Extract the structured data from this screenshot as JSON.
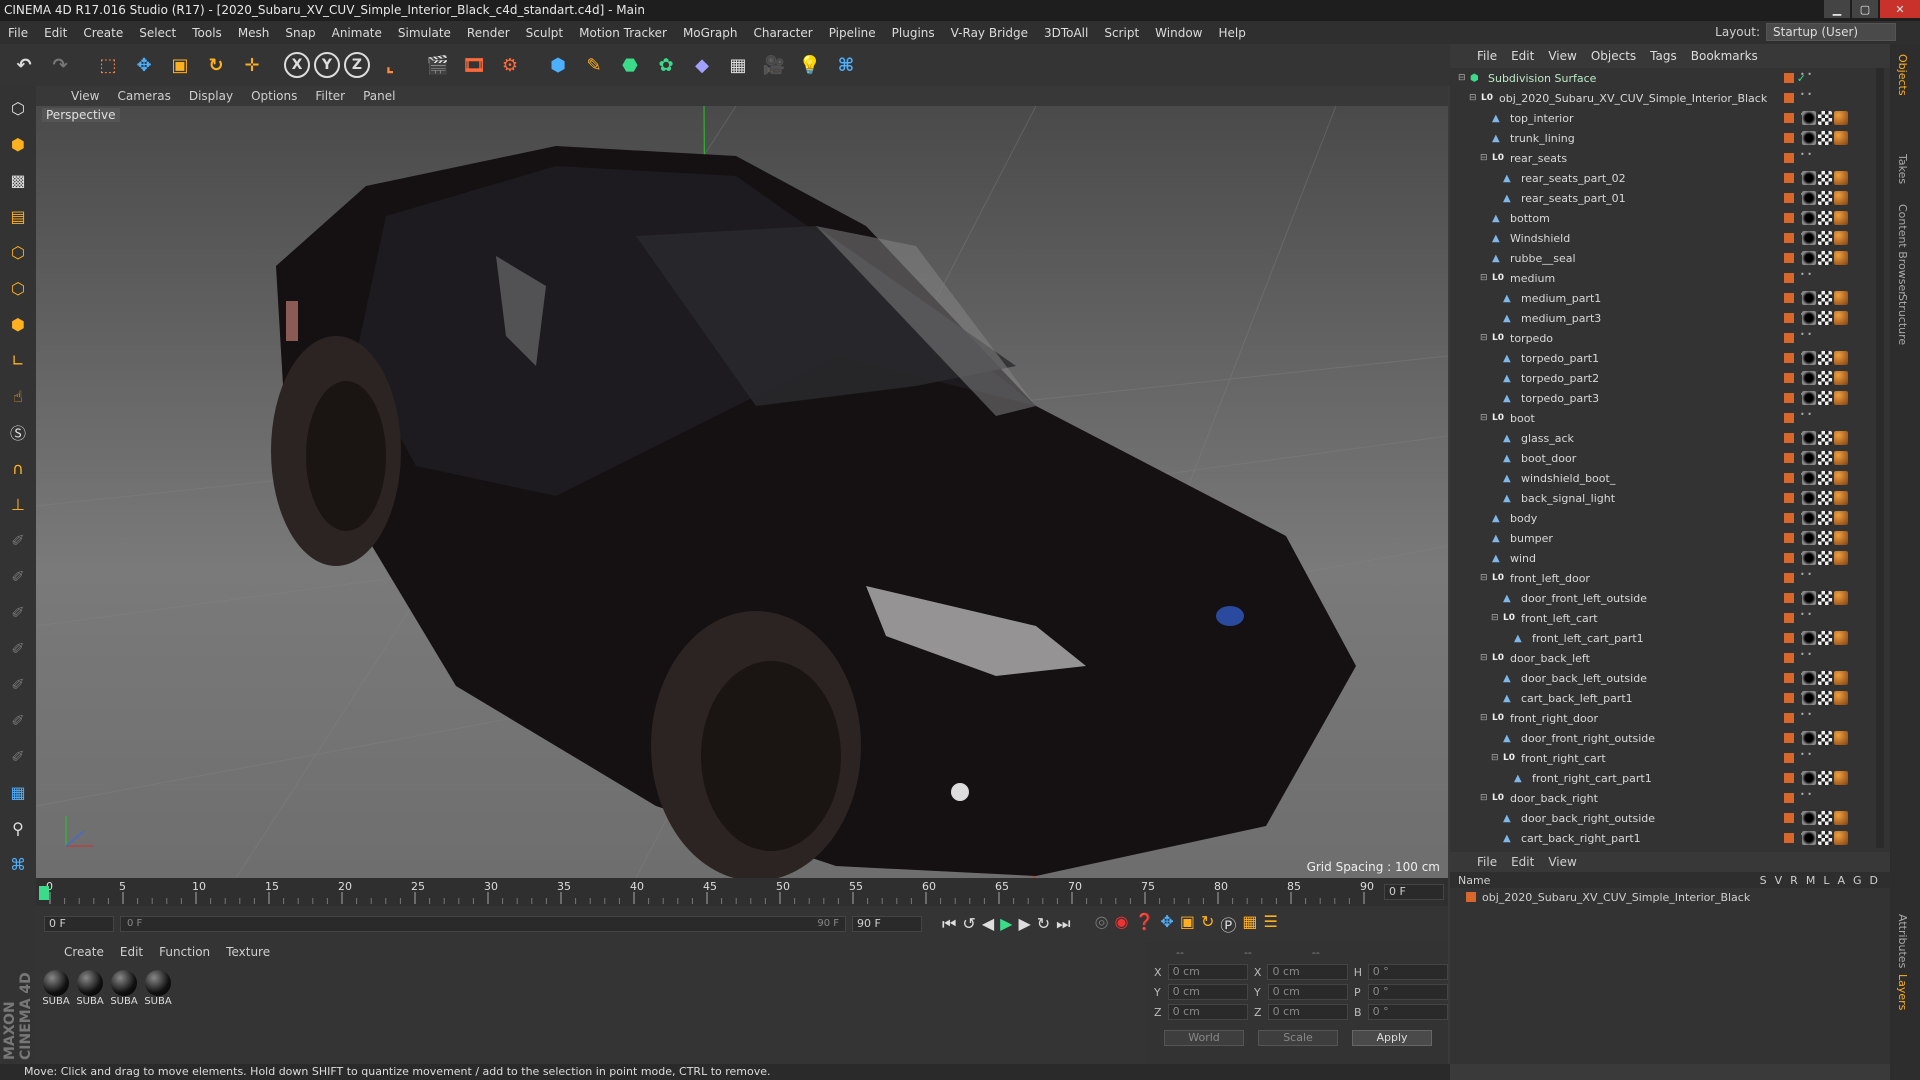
{
  "window": {
    "title": "CINEMA 4D R17.016 Studio (R17) - [2020_Subaru_XV_CUV_Simple_Interior_Black_c4d_standart.c4d] - Main"
  },
  "menu": [
    "File",
    "Edit",
    "Create",
    "Select",
    "Tools",
    "Mesh",
    "Snap",
    "Animate",
    "Simulate",
    "Render",
    "Sculpt",
    "Motion Tracker",
    "MoGraph",
    "Character",
    "Pipeline",
    "Plugins",
    "V-Ray Bridge",
    "3DToAll",
    "Script",
    "Window",
    "Help"
  ],
  "layout": {
    "label": "Layout:",
    "value": "Startup (User)"
  },
  "viewport": {
    "menu": [
      "View",
      "Cameras",
      "Display",
      "Options",
      "Filter",
      "Panel"
    ],
    "label": "Perspective",
    "grid_spacing": "Grid Spacing : 100 cm"
  },
  "timeline": {
    "ticks": [
      "0",
      "5",
      "10",
      "15",
      "20",
      "25",
      "30",
      "35",
      "40",
      "45",
      "50",
      "55",
      "60",
      "65",
      "70",
      "75",
      "80",
      "85",
      "90"
    ],
    "frame_end_label": "0 F",
    "start_field": "0 F",
    "range_start": "0 F",
    "range_end": "90 F",
    "end_field": "90 F"
  },
  "materials": {
    "menu": [
      "Create",
      "Edit",
      "Function",
      "Texture"
    ],
    "items": [
      "SUBA",
      "SUBA",
      "SUBA",
      "SUBA"
    ]
  },
  "coords": {
    "dashes": [
      "--",
      "--",
      "--"
    ],
    "rows": [
      {
        "a": "X",
        "av": "0 cm",
        "b": "X",
        "bv": "0 cm",
        "c": "H",
        "cv": "0 °"
      },
      {
        "a": "Y",
        "av": "0 cm",
        "b": "Y",
        "bv": "0 cm",
        "c": "P",
        "cv": "0 °"
      },
      {
        "a": "Z",
        "av": "0 cm",
        "b": "Z",
        "bv": "0 cm",
        "c": "B",
        "cv": "0 °"
      }
    ],
    "world": "World",
    "scale": "Scale",
    "apply": "Apply"
  },
  "status": "Move: Click and drag to move elements. Hold down SHIFT to quantize movement / add to the selection in point mode, CTRL to remove.",
  "objects": {
    "menu": [
      "File",
      "Edit",
      "View",
      "Objects",
      "Tags",
      "Bookmarks"
    ],
    "tree": [
      {
        "name": "Subdivision Surface",
        "level": 0,
        "kind": "sds",
        "tags": false
      },
      {
        "name": "obj_2020_Subaru_XV_CUV_Simple_Interior_Black",
        "level": 1,
        "kind": "null",
        "tags": false
      },
      {
        "name": "top_interior",
        "level": 2,
        "kind": "obj",
        "tags": true
      },
      {
        "name": "trunk_lining",
        "level": 2,
        "kind": "obj",
        "tags": true
      },
      {
        "name": "rear_seats",
        "level": 2,
        "kind": "null",
        "tags": false
      },
      {
        "name": "rear_seats_part_02",
        "level": 3,
        "kind": "obj",
        "tags": true
      },
      {
        "name": "rear_seats_part_01",
        "level": 3,
        "kind": "obj",
        "tags": true
      },
      {
        "name": "bottom",
        "level": 2,
        "kind": "obj",
        "tags": true
      },
      {
        "name": "Windshield",
        "level": 2,
        "kind": "obj",
        "tags": true
      },
      {
        "name": "rubbe__seal",
        "level": 2,
        "kind": "obj",
        "tags": true
      },
      {
        "name": "medium",
        "level": 2,
        "kind": "null",
        "tags": false
      },
      {
        "name": "medium_part1",
        "level": 3,
        "kind": "obj",
        "tags": true
      },
      {
        "name": "medium_part3",
        "level": 3,
        "kind": "obj",
        "tags": true
      },
      {
        "name": "torpedo",
        "level": 2,
        "kind": "null",
        "tags": false
      },
      {
        "name": "torpedo_part1",
        "level": 3,
        "kind": "obj",
        "tags": true
      },
      {
        "name": "torpedo_part2",
        "level": 3,
        "kind": "obj",
        "tags": true
      },
      {
        "name": "torpedo_part3",
        "level": 3,
        "kind": "obj",
        "tags": true
      },
      {
        "name": "boot",
        "level": 2,
        "kind": "null",
        "tags": false
      },
      {
        "name": "glass_ack",
        "level": 3,
        "kind": "obj",
        "tags": true
      },
      {
        "name": "boot_door",
        "level": 3,
        "kind": "obj",
        "tags": true
      },
      {
        "name": "windshield_boot_",
        "level": 3,
        "kind": "obj",
        "tags": true
      },
      {
        "name": "back_signal_light",
        "level": 3,
        "kind": "obj",
        "tags": true
      },
      {
        "name": "body",
        "level": 2,
        "kind": "obj",
        "tags": true
      },
      {
        "name": "bumper",
        "level": 2,
        "kind": "obj",
        "tags": true
      },
      {
        "name": "wind",
        "level": 2,
        "kind": "obj",
        "tags": true
      },
      {
        "name": "front_left_door",
        "level": 2,
        "kind": "null",
        "tags": false
      },
      {
        "name": "door_front_left_outside",
        "level": 3,
        "kind": "obj",
        "tags": true
      },
      {
        "name": "front_left_cart",
        "level": 3,
        "kind": "null",
        "tags": false
      },
      {
        "name": "front_left_cart_part1",
        "level": 4,
        "kind": "obj",
        "tags": true
      },
      {
        "name": "door_back_left",
        "level": 2,
        "kind": "null",
        "tags": false
      },
      {
        "name": "door_back_left_outside",
        "level": 3,
        "kind": "obj",
        "tags": true
      },
      {
        "name": "cart_back_left_part1",
        "level": 3,
        "kind": "obj",
        "tags": true
      },
      {
        "name": "front_right_door",
        "level": 2,
        "kind": "null",
        "tags": false
      },
      {
        "name": "door_front_right_outside",
        "level": 3,
        "kind": "obj",
        "tags": true
      },
      {
        "name": "front_right_cart",
        "level": 3,
        "kind": "null",
        "tags": false
      },
      {
        "name": "front_right_cart_part1",
        "level": 4,
        "kind": "obj",
        "tags": true
      },
      {
        "name": "door_back_right",
        "level": 2,
        "kind": "null",
        "tags": false
      },
      {
        "name": "door_back_right_outside",
        "level": 3,
        "kind": "obj",
        "tags": true
      },
      {
        "name": "cart_back_right_part1",
        "level": 3,
        "kind": "obj",
        "tags": true
      }
    ]
  },
  "layers": {
    "menu": [
      "File",
      "Edit",
      "View"
    ],
    "header": "Name",
    "cols": [
      "S",
      "V",
      "R",
      "M",
      "L",
      "A",
      "G",
      "D"
    ],
    "row": "obj_2020_Subaru_XV_CUV_Simple_Interior_Black"
  },
  "right_tabs": [
    "Objects",
    "Takes",
    "Content Browser",
    "Structure",
    "Attributes",
    "Layers"
  ]
}
